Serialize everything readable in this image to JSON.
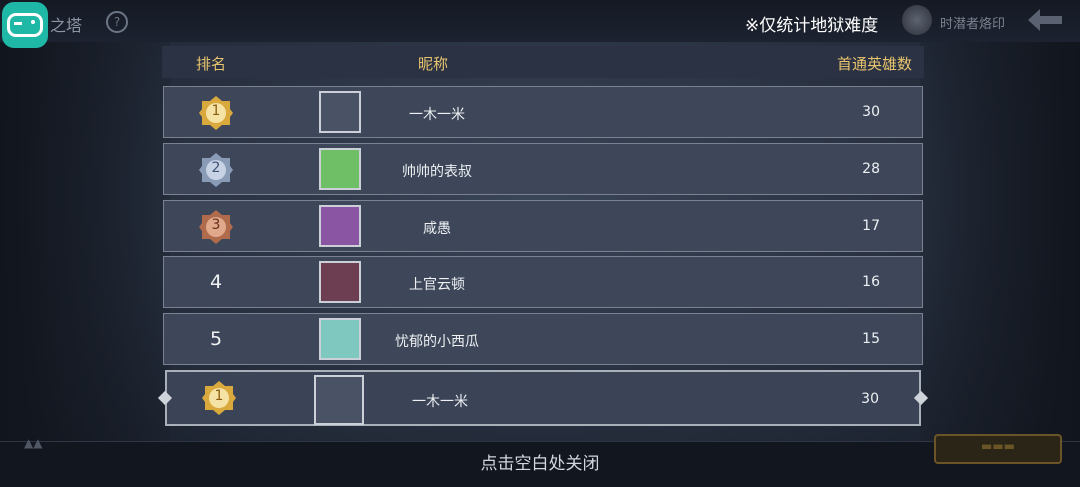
{
  "top": {
    "tower_title": "之塔",
    "help_glyph": "?",
    "notice": "※仅统计地狱难度",
    "crest_label": "时潜者烙印"
  },
  "table": {
    "headers": {
      "rank": "排名",
      "nickname": "昵称",
      "heroes": "首通英雄数"
    },
    "rows": [
      {
        "rank": "1",
        "badge": "gold",
        "name": "一木一米",
        "score": "30",
        "avatar": "#4a5366"
      },
      {
        "rank": "2",
        "badge": "silver",
        "name": "帅帅的表叔",
        "score": "28",
        "avatar": "#6fbf66"
      },
      {
        "rank": "3",
        "badge": "bronze",
        "name": "咸愚",
        "score": "17",
        "avatar": "#8a56a3"
      },
      {
        "rank": "4",
        "badge": "none",
        "name": "上官云顿",
        "score": "16",
        "avatar": "#6d3e52"
      },
      {
        "rank": "5",
        "badge": "none",
        "name": "忧郁的小西瓜",
        "score": "15",
        "avatar": "#7fc8c0"
      }
    ],
    "mine": {
      "rank": "1",
      "badge": "gold",
      "name": "一木一米",
      "score": "30",
      "avatar": "#4a5366"
    }
  },
  "bottom": {
    "close_hint": "点击空白处关闭"
  },
  "colors": {
    "header_text": "#e9c46e",
    "row_bg": "#3d4759",
    "gold": "#d9a93d",
    "silver": "#8a9bb8",
    "bronze": "#b06a4c"
  }
}
